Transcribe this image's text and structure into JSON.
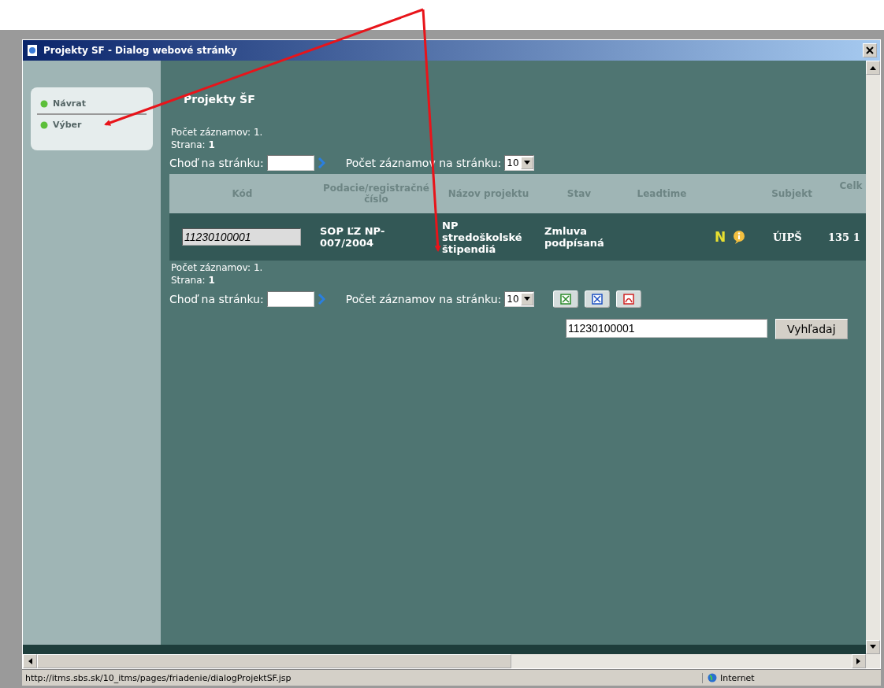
{
  "window": {
    "title": "Projekty SF - Dialog webové stránky"
  },
  "sidebar": {
    "items": [
      {
        "label": "Návrat"
      },
      {
        "label": "Výber"
      }
    ]
  },
  "page_title": "Projekty ŠF",
  "pager_top": {
    "count_label": "Počet záznamov: 1.",
    "page_label": "Strana:",
    "page": "1",
    "goto_label": "Choď na stránku:",
    "per_page_label": "Počet záznamov na stránku:",
    "per_page": "10"
  },
  "table": {
    "columns": [
      "Kód",
      "Podacie/registračné číslo",
      "Názov projektu",
      "Stav",
      "Leadtime",
      "Subjekt",
      "Celk"
    ],
    "rows": [
      {
        "code": "11230100001",
        "reg_number": "SOP ĽZ NP-007/2004",
        "name": "NP stredoškolské štipendiá",
        "state": "Zmluva podpísaná",
        "flag": "N",
        "subject": "ÚIPŠ",
        "total": "135 1"
      }
    ]
  },
  "pager_bottom": {
    "count_label": "Počet záznamov: 1.",
    "page_label": "Strana:",
    "page": "1",
    "goto_label": "Choď na stránku:",
    "per_page_label": "Počet záznamov na stránku:",
    "per_page": "10"
  },
  "exports": [
    {
      "kind": "excel"
    },
    {
      "kind": "word"
    },
    {
      "kind": "pdf"
    }
  ],
  "search": {
    "value": "11230100001",
    "button": "Vyhľadaj"
  },
  "status_bar": {
    "url": "http://itms.sbs.sk/10_itms/pages/friadenie/dialogProjektSF.jsp",
    "zone": "Internet"
  }
}
